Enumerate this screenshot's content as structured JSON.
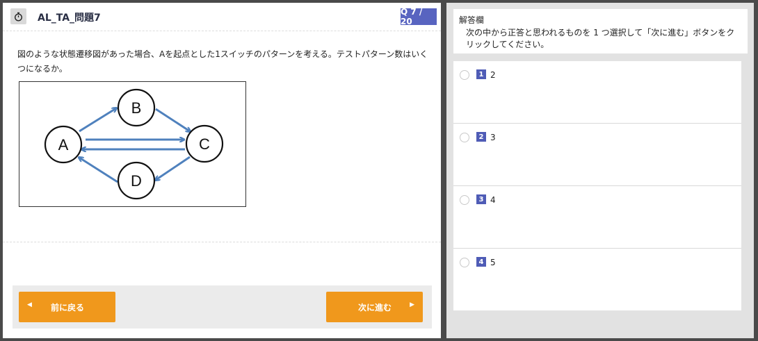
{
  "header": {
    "title": "AL_TA_問題7",
    "counter": "Q 7 / 20"
  },
  "question": {
    "text": "図のような状態遷移図があった場合、Aを起点とした1スイッチのパターンを考える。テストパターン数はいくつになるか。"
  },
  "diagram": {
    "nodes": [
      "A",
      "B",
      "C",
      "D"
    ],
    "edge_color": "#4f81bd"
  },
  "navigation": {
    "prev_label": "前に戻る",
    "next_label": "次に進む",
    "button_color": "#f0981c"
  },
  "answer": {
    "title": "解答欄",
    "instruction": "次の中から正答と思われるものを 1 つ選択して「次に進む」ボタンをクリックしてください。",
    "options": [
      {
        "num": "1",
        "text": "2"
      },
      {
        "num": "2",
        "text": "3"
      },
      {
        "num": "3",
        "text": "4"
      },
      {
        "num": "4",
        "text": "5"
      }
    ]
  },
  "colors": {
    "accent": "#5864c0",
    "option_badge": "#4f5cb6"
  }
}
